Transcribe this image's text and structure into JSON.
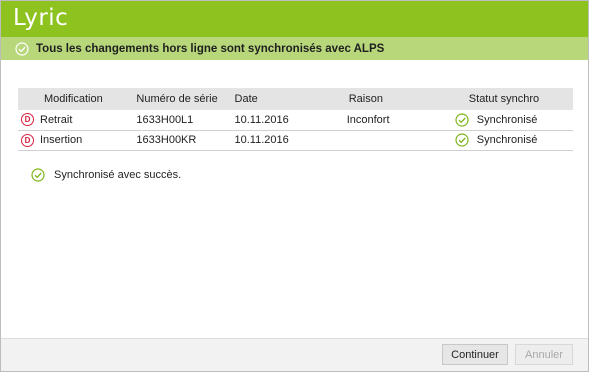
{
  "app": {
    "logo_text": "Lyric"
  },
  "banner": {
    "message": "Tous les changements hors ligne sont synchronisés avec ALPS"
  },
  "table": {
    "headers": [
      "Modification",
      "Numéro de série",
      "Date",
      "Raison",
      "Statut synchro"
    ],
    "rows": [
      {
        "badge": "D",
        "modification": "Retrait",
        "serial": "1633H00L1",
        "date": "10.11.2016",
        "reason": "Inconfort",
        "status": "Synchronisé"
      },
      {
        "badge": "D",
        "modification": "Insertion",
        "serial": "1633H00KR",
        "date": "10.11.2016",
        "reason": "",
        "status": "Synchronisé"
      }
    ]
  },
  "success_message": "Synchronisé avec succès.",
  "buttons": {
    "continue_label": "Continuer",
    "cancel_label": "Annuler"
  },
  "colors": {
    "title_bar": "#8dc21f",
    "banner": "#b7d77a",
    "check": "#7fb51d",
    "delete_badge": "#d6203f"
  },
  "icons": {
    "check": "check-circle-icon",
    "delete": "delete-badge-icon"
  }
}
